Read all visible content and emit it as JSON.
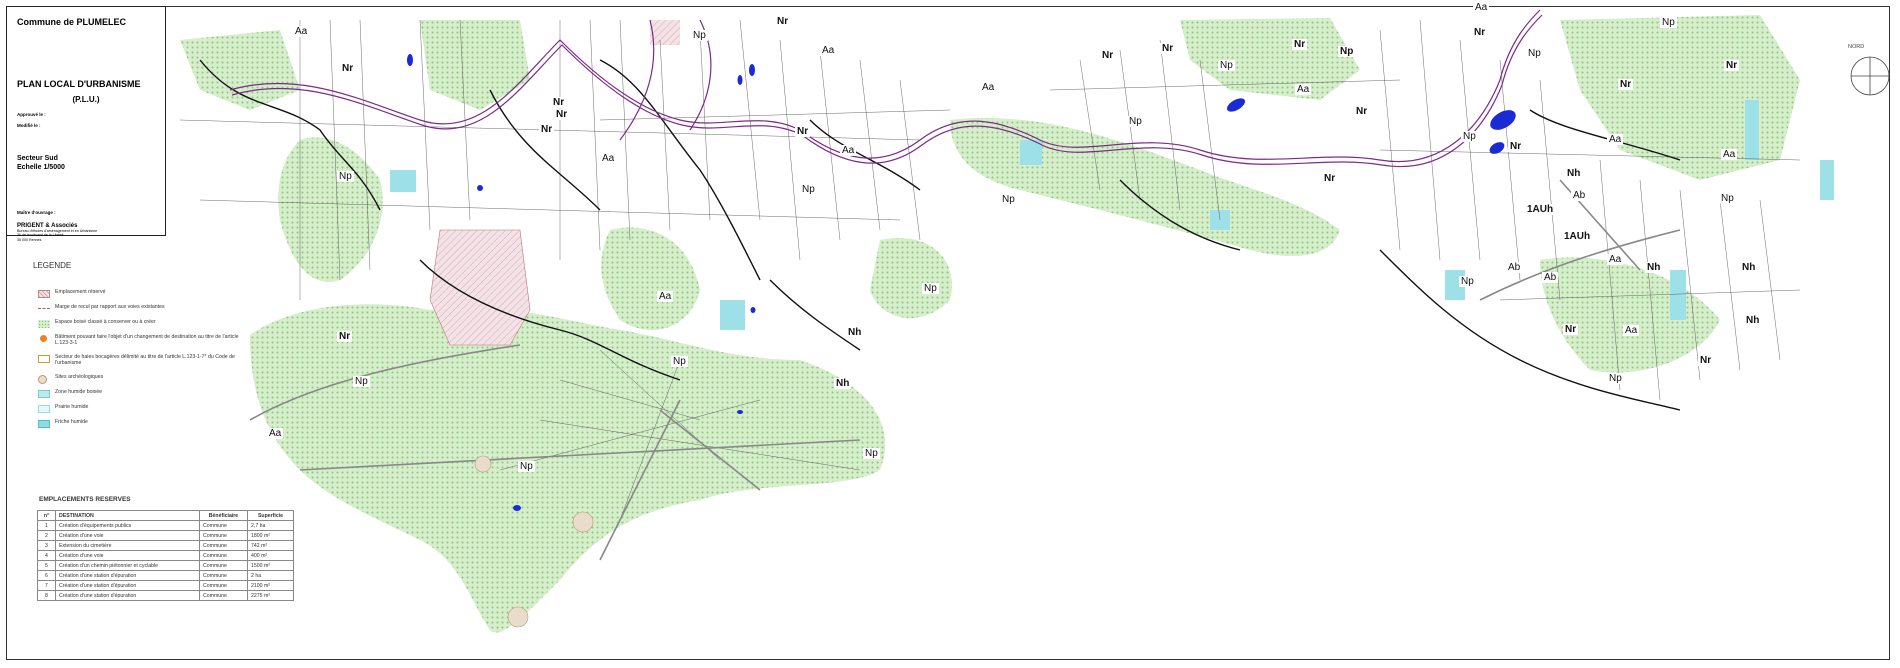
{
  "title_block": {
    "commune": "Commune de PLUMELEC",
    "plan": "PLAN LOCAL D'URBANISME",
    "plan_short": "(P.L.U.)",
    "approved": "Approuvé le :",
    "modified": "Modifié le :",
    "sector": "Secteur Sud",
    "scale": "Echelle 1/5000",
    "maitre": "Maître d'ouvrage :",
    "firm": "PRIGENT & Associés",
    "firm_line1": "Bureau d'études d'aménagement et en Urbanisme",
    "firm_line2": "36 de boulevard de la Liberté",
    "firm_line3": "35 000 Rennes"
  },
  "north_label": "NORD",
  "legend": {
    "title": "LEGENDE",
    "items": [
      {
        "label": "Emplacement réservé",
        "swatch": "reserved"
      },
      {
        "label": "Marge de recul par rapport aux voies existantes",
        "swatch": "margin"
      },
      {
        "label": "Espace boisé classé à conserver ou à créer",
        "swatch": "wood"
      },
      {
        "label": "Bâtiment pouvant faire l'objet d'un changement de destination au titre de l'article L.123-3-1",
        "swatch": "building"
      },
      {
        "label": "Secteur de haies bocagères délimité au titre de l'article L.123-1-7° du Code de l'urbanisme",
        "swatch": "hedge"
      },
      {
        "label": "Sites archéologiques",
        "swatch": "archeo"
      },
      {
        "label": "Zone humide boisée",
        "swatch": "wet1"
      },
      {
        "label": "Prairie humide",
        "swatch": "wet2"
      },
      {
        "label": "Friche humide",
        "swatch": "wet3"
      }
    ]
  },
  "reserved_sites": {
    "title": "EMPLACEMENTS RESERVES",
    "headers": [
      "n°",
      "DESTINATION",
      "Bénéficiaire",
      "Superficie"
    ],
    "rows": [
      [
        "1",
        "Création d'équipements publics",
        "Commune",
        "2,7 ha"
      ],
      [
        "2",
        "Création d'une voie",
        "Commune",
        "1800 m²"
      ],
      [
        "3",
        "Extension du cimetière",
        "Commune",
        "742 m²"
      ],
      [
        "4",
        "Création d'une voie",
        "Commune",
        "400 m²"
      ],
      [
        "5",
        "Création d'un chemin piétonnier et cyclable",
        "Commune",
        "1500 m²"
      ],
      [
        "6",
        "Création d'une station d'épuration",
        "Commune",
        "2 ha"
      ],
      [
        "7",
        "Création d'une station d'épuration",
        "Commune",
        "2100 m²"
      ],
      [
        "8",
        "Création d'une station d'épuration",
        "Commune",
        "2275 m²"
      ]
    ]
  },
  "zones": {
    "aa_1": "Aa",
    "nr_1": "Nr",
    "np_1": "Np",
    "np_2": "Np",
    "aa_2": "Aa",
    "nr_2": "Nr",
    "nr_3": "Nr",
    "aa_3": "Aa",
    "nr_4": "Nr",
    "nr_5": "Nr",
    "aa_4": "Aa",
    "np_3": "Np",
    "np_4": "Np",
    "aa_5": "Aa",
    "nr_6": "Nr",
    "nr_7": "Nr",
    "np_5": "Np",
    "nr_8": "Nr",
    "np_6": "Np",
    "aa_6": "Aa",
    "nr_9": "Nr",
    "nr_10": "Nr",
    "np_7": "Np",
    "aa_7": "Aa",
    "nr_11": "Nr",
    "nr_12": "Nr",
    "np_8": "Np",
    "np_9": "Np",
    "aa_8": "Aa",
    "np_10": "Np",
    "nr_13": "Nr",
    "nr_14": "Nr",
    "aa_9": "Aa",
    "np_11": "Np",
    "aa_10": "Aa",
    "nh_1": "Nh",
    "np_12": "Np",
    "np_13": "Np",
    "nh_2": "Nh",
    "np_14": "Np",
    "aa_11": "Aa",
    "np_15": "Np",
    "np_16": "Np",
    "nh_3": "Nh",
    "ab_1": "Ab",
    "auh_1": "1AUh",
    "auh_2": "1AUh",
    "ab_2": "Ab",
    "ab_3": "Ab",
    "nh_4": "Nh",
    "nh_5": "Nh",
    "nh_6": "Nh",
    "nr_15": "Nr",
    "aa_12": "Aa",
    "nr_16": "Nr",
    "np_17": "Np",
    "np_18": "Np",
    "nr_17": "Nr",
    "nr_18": "Nr",
    "aa_13": "Aa"
  },
  "colors": {
    "wood_green": "#cfe9c4",
    "wood_dot": "#7fbf70",
    "wetland": "#8fdbe3",
    "river": "#7d2a8a",
    "water_blue": "#1a2bd6",
    "reserved_pink": "#e9c9d0",
    "road": "#9a9a9a"
  }
}
